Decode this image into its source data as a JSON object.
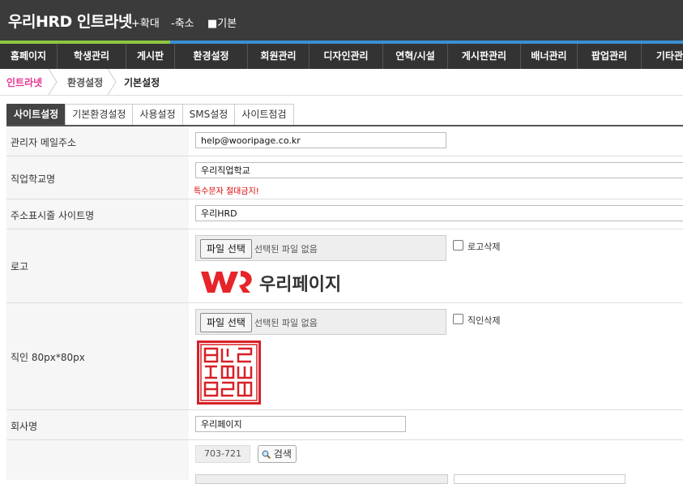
{
  "header": {
    "title": "우리HRD 인트라넷",
    "zoom_in": "+확대",
    "zoom_out": "-축소",
    "zoom_default": "■기본"
  },
  "nav": {
    "items": [
      "홈페이지",
      "학생관리",
      "게시판",
      "환경설정",
      "회원관리",
      "디자인관리",
      "연혁/시설",
      "게시판관리",
      "배너관리",
      "팝업관리",
      "기타관리"
    ]
  },
  "breadcrumb": {
    "items": [
      "인트라넷",
      "환경설정",
      "기본설정"
    ]
  },
  "tabs": [
    "사이트설정",
    "기본환경설정",
    "사용설정",
    "SMS설정",
    "사이트점검"
  ],
  "form": {
    "admin_email": {
      "label": "관리자 메일주소",
      "value": "help@wooripage.co.kr"
    },
    "school_name": {
      "label": "직업학교명",
      "value": "우리직업학교",
      "warning": "특수문자 절대금지!"
    },
    "site_name": {
      "label": "주소표시줄 사이트명",
      "value": "우리HRD"
    },
    "logo": {
      "label": "로고",
      "file_button": "파일 선택",
      "file_status": "선택된 파일 없음",
      "delete_label": "로고삭제",
      "logo_text": "우리페이지"
    },
    "seal": {
      "label": "직인 80px*80px",
      "file_button": "파일 선택",
      "file_status": "선택된 파일 없음",
      "delete_label": "직인삭제"
    },
    "company": {
      "label": "회사명",
      "value": "우리페이지"
    },
    "address": {
      "zipcode": "703-721",
      "search_label": "검색"
    }
  },
  "colors": {
    "topbar": "#3b3b3b",
    "nav": "#333333",
    "accent_green": "#8dc63f",
    "accent_blue": "#3b8fd3",
    "breadcrumb_active": "#e5358f",
    "warning": "#dd0000"
  }
}
